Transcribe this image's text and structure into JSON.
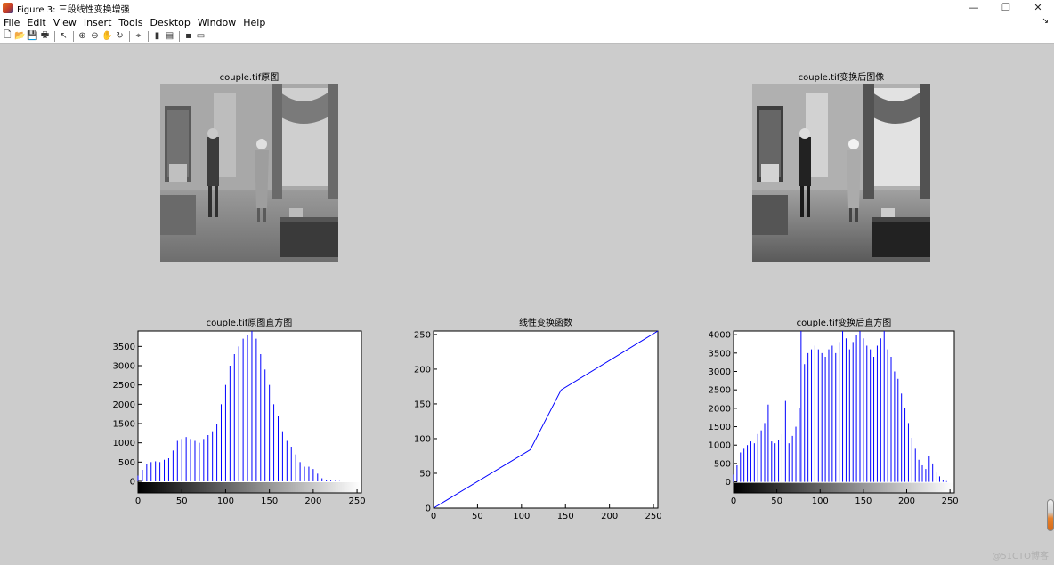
{
  "window": {
    "title": "Figure 3: 三段线性变换增强",
    "controls": {
      "minimize": "—",
      "restore": "❐",
      "close": "✕"
    }
  },
  "menu": [
    "File",
    "Edit",
    "View",
    "Insert",
    "Tools",
    "Desktop",
    "Window",
    "Help"
  ],
  "menu_dock_arrow": "↘",
  "toolbar": [
    {
      "name": "new-figure-icon",
      "glyph": "🗋"
    },
    {
      "name": "open-file-icon",
      "glyph": "📂"
    },
    {
      "name": "save-icon",
      "glyph": "💾"
    },
    {
      "name": "print-icon",
      "glyph": "🖶"
    },
    {
      "sep": true
    },
    {
      "name": "edit-plot-arrow-icon",
      "glyph": "↖"
    },
    {
      "sep": true
    },
    {
      "name": "zoom-in-icon",
      "glyph": "⊕"
    },
    {
      "name": "zoom-out-icon",
      "glyph": "⊖"
    },
    {
      "name": "pan-hand-icon",
      "glyph": "✋"
    },
    {
      "name": "rotate-3d-icon",
      "glyph": "↻"
    },
    {
      "sep": true
    },
    {
      "name": "data-cursor-icon",
      "glyph": "⌖"
    },
    {
      "sep": true
    },
    {
      "name": "insert-colorbar-icon",
      "glyph": "▮"
    },
    {
      "name": "insert-legend-icon",
      "glyph": "▤"
    },
    {
      "sep": true
    },
    {
      "name": "hide-plot-tools-icon",
      "glyph": "▪"
    },
    {
      "name": "show-plot-tools-icon",
      "glyph": "▭"
    }
  ],
  "subplots": {
    "original_image_title": "couple.tif原图",
    "transformed_image_title": "couple.tif变换后图像",
    "original_hist_title": "couple.tif原图直方图",
    "transform_func_title": "线性变换函数",
    "transformed_hist_title": "couple.tif变换后直方图"
  },
  "watermark": "@51CTO博客",
  "chart_data": [
    {
      "type": "bar",
      "title": "couple.tif原图直方图",
      "xlabel": "",
      "ylabel": "",
      "xlim": [
        0,
        255
      ],
      "ylim": [
        -300,
        3900
      ],
      "xticks": [
        0,
        50,
        100,
        150,
        200,
        250
      ],
      "yticks": [
        0,
        500,
        1000,
        1500,
        2000,
        2500,
        3000,
        3500
      ],
      "colorbar": "gray",
      "color": "#0000ff",
      "x": [
        0,
        5,
        10,
        15,
        20,
        25,
        30,
        35,
        40,
        45,
        50,
        55,
        60,
        65,
        70,
        75,
        80,
        85,
        90,
        95,
        100,
        105,
        110,
        115,
        120,
        125,
        130,
        135,
        140,
        145,
        150,
        155,
        160,
        165,
        170,
        175,
        180,
        185,
        190,
        195,
        200,
        205,
        210,
        215,
        220,
        225,
        230,
        235,
        240,
        245,
        250
      ],
      "values": [
        150,
        300,
        450,
        500,
        520,
        500,
        560,
        600,
        800,
        1050,
        1100,
        1150,
        1100,
        1050,
        1000,
        1100,
        1200,
        1300,
        1500,
        2000,
        2500,
        3000,
        3300,
        3500,
        3700,
        3800,
        3900,
        3700,
        3300,
        2900,
        2500,
        2000,
        1700,
        1300,
        1050,
        900,
        700,
        500,
        380,
        380,
        320,
        200,
        80,
        40,
        20,
        10,
        5,
        0,
        0,
        0,
        0
      ]
    },
    {
      "type": "line",
      "title": "线性变换函数",
      "xlabel": "",
      "ylabel": "",
      "xlim": [
        0,
        255
      ],
      "ylim": [
        0,
        255
      ],
      "xticks": [
        0,
        50,
        100,
        150,
        200,
        250
      ],
      "yticks": [
        0,
        50,
        100,
        150,
        200,
        250
      ],
      "color": "#0000ff",
      "x": [
        0,
        110,
        145,
        255
      ],
      "values": [
        0,
        84,
        170,
        255
      ]
    },
    {
      "type": "bar",
      "title": "couple.tif变换后直方图",
      "xlabel": "",
      "ylabel": "",
      "xlim": [
        0,
        255
      ],
      "ylim": [
        -300,
        4100
      ],
      "xticks": [
        0,
        50,
        100,
        150,
        200,
        250
      ],
      "yticks": [
        0,
        500,
        1000,
        1500,
        2000,
        2500,
        3000,
        3500,
        4000
      ],
      "colorbar": "gray",
      "color": "#0000ff",
      "x": [
        0,
        4,
        8,
        12,
        16,
        20,
        24,
        28,
        32,
        36,
        40,
        44,
        48,
        52,
        56,
        60,
        64,
        68,
        72,
        76,
        78,
        82,
        86,
        90,
        94,
        98,
        102,
        106,
        110,
        114,
        118,
        122,
        126,
        130,
        134,
        138,
        142,
        146,
        150,
        154,
        158,
        162,
        166,
        170,
        174,
        178,
        182,
        186,
        190,
        194,
        198,
        202,
        206,
        210,
        214,
        218,
        222,
        226,
        230,
        234,
        238,
        242,
        246,
        250
      ],
      "values": [
        200,
        450,
        800,
        900,
        1000,
        1100,
        1050,
        1300,
        1400,
        1600,
        2100,
        1100,
        1050,
        1150,
        1300,
        2200,
        1050,
        1250,
        1500,
        2000,
        4100,
        3200,
        3500,
        3600,
        3700,
        3600,
        3500,
        3400,
        3600,
        3700,
        3500,
        3800,
        4100,
        3900,
        3600,
        3800,
        4000,
        4100,
        3900,
        3700,
        3600,
        3400,
        3700,
        3900,
        4100,
        3600,
        3400,
        3000,
        2800,
        2400,
        2000,
        1600,
        1200,
        900,
        600,
        450,
        350,
        700,
        500,
        250,
        150,
        60,
        20,
        0
      ]
    }
  ]
}
